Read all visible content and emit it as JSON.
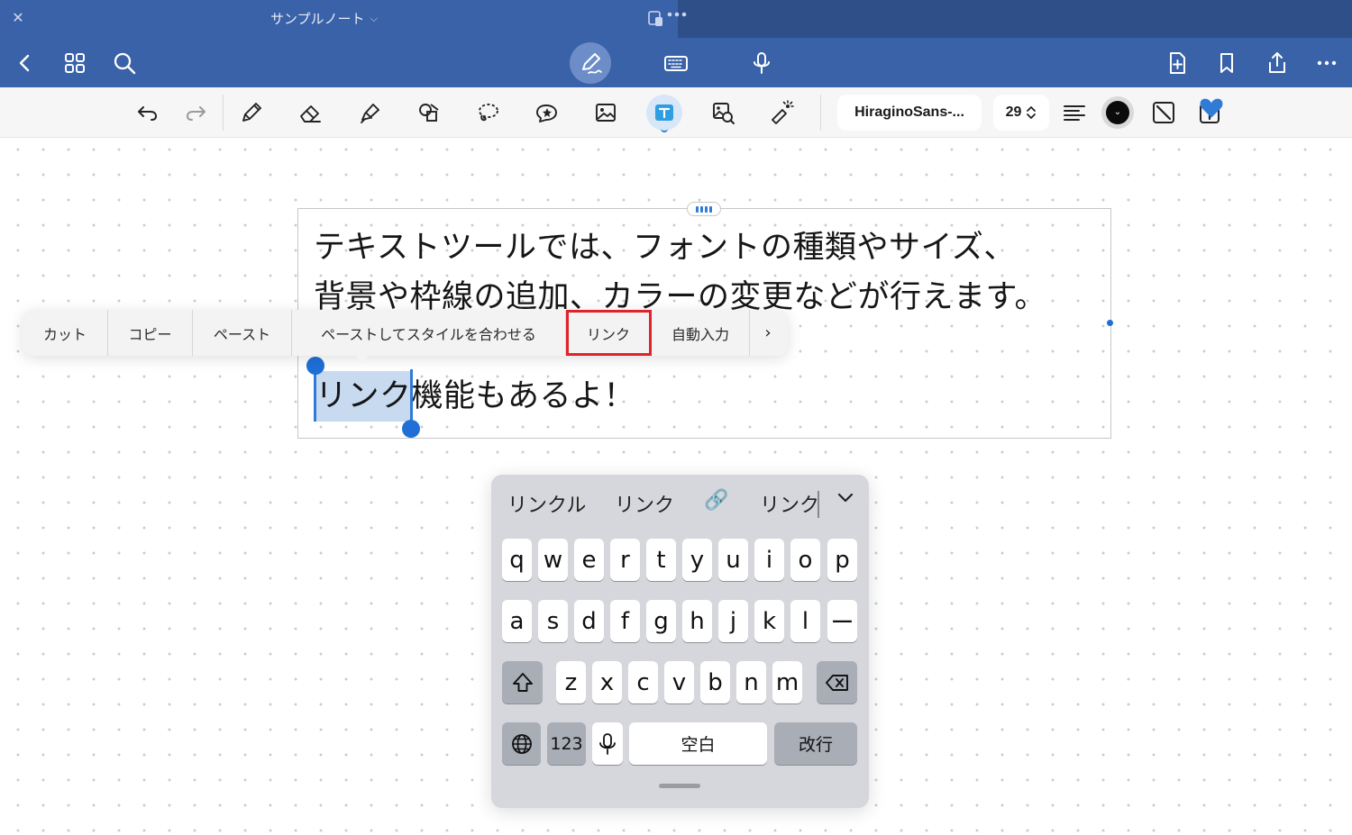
{
  "window": {
    "title": "サンプルノート",
    "close_icon": "close-icon",
    "title_chevron": "chevron-down-icon"
  },
  "navbar": {
    "left": [
      "back-icon",
      "grid-icon",
      "search-icon"
    ],
    "center": [
      "pen-mode-icon",
      "keyboard-icon",
      "microphone-icon"
    ],
    "right": [
      "add-page-icon",
      "bookmark-icon",
      "share-icon",
      "more-icon"
    ]
  },
  "toolbar": {
    "tools": [
      "undo-icon",
      "redo-icon",
      "pencil-icon",
      "eraser-icon",
      "highlighter-icon",
      "shapes-icon",
      "lasso-icon",
      "sticker-icon",
      "image-icon",
      "text-tool-icon",
      "image-search-icon",
      "laser-pointer-icon"
    ],
    "font_name": "HiraginoSans-...",
    "font_size": "29",
    "align": "align-left-icon",
    "text_color": "#0b0b0b",
    "active_tool": "text-tool-icon"
  },
  "textbox": {
    "line1": "テキストツールでは、フォントの種類やサイズ、",
    "line2": "背景や枠線の追加、カラーの変更などが行えます。",
    "line3_selected": "リンク",
    "line3_rest": "機能もあるよ！"
  },
  "context_menu": {
    "items": [
      "カット",
      "コピー",
      "ペースト",
      "ペーストしてスタイルを合わせる",
      "リンク",
      "自動入力"
    ],
    "highlighted": "リンク",
    "more": "›"
  },
  "keyboard": {
    "candidates": [
      "リンクル",
      "リンク",
      "🔗",
      "リンク"
    ],
    "row1": [
      "q",
      "w",
      "e",
      "r",
      "t",
      "y",
      "u",
      "i",
      "o",
      "p"
    ],
    "row2": [
      "a",
      "s",
      "d",
      "f",
      "g",
      "h",
      "j",
      "k",
      "l",
      "ー"
    ],
    "row3": [
      "z",
      "x",
      "c",
      "v",
      "b",
      "n",
      "m"
    ],
    "numbers_label": "123",
    "space_label": "空白",
    "return_label": "改行"
  },
  "colors": {
    "titlebar": "#3a62a8",
    "accent": "#1f6fd6",
    "highlight_box": "#e0232b"
  }
}
